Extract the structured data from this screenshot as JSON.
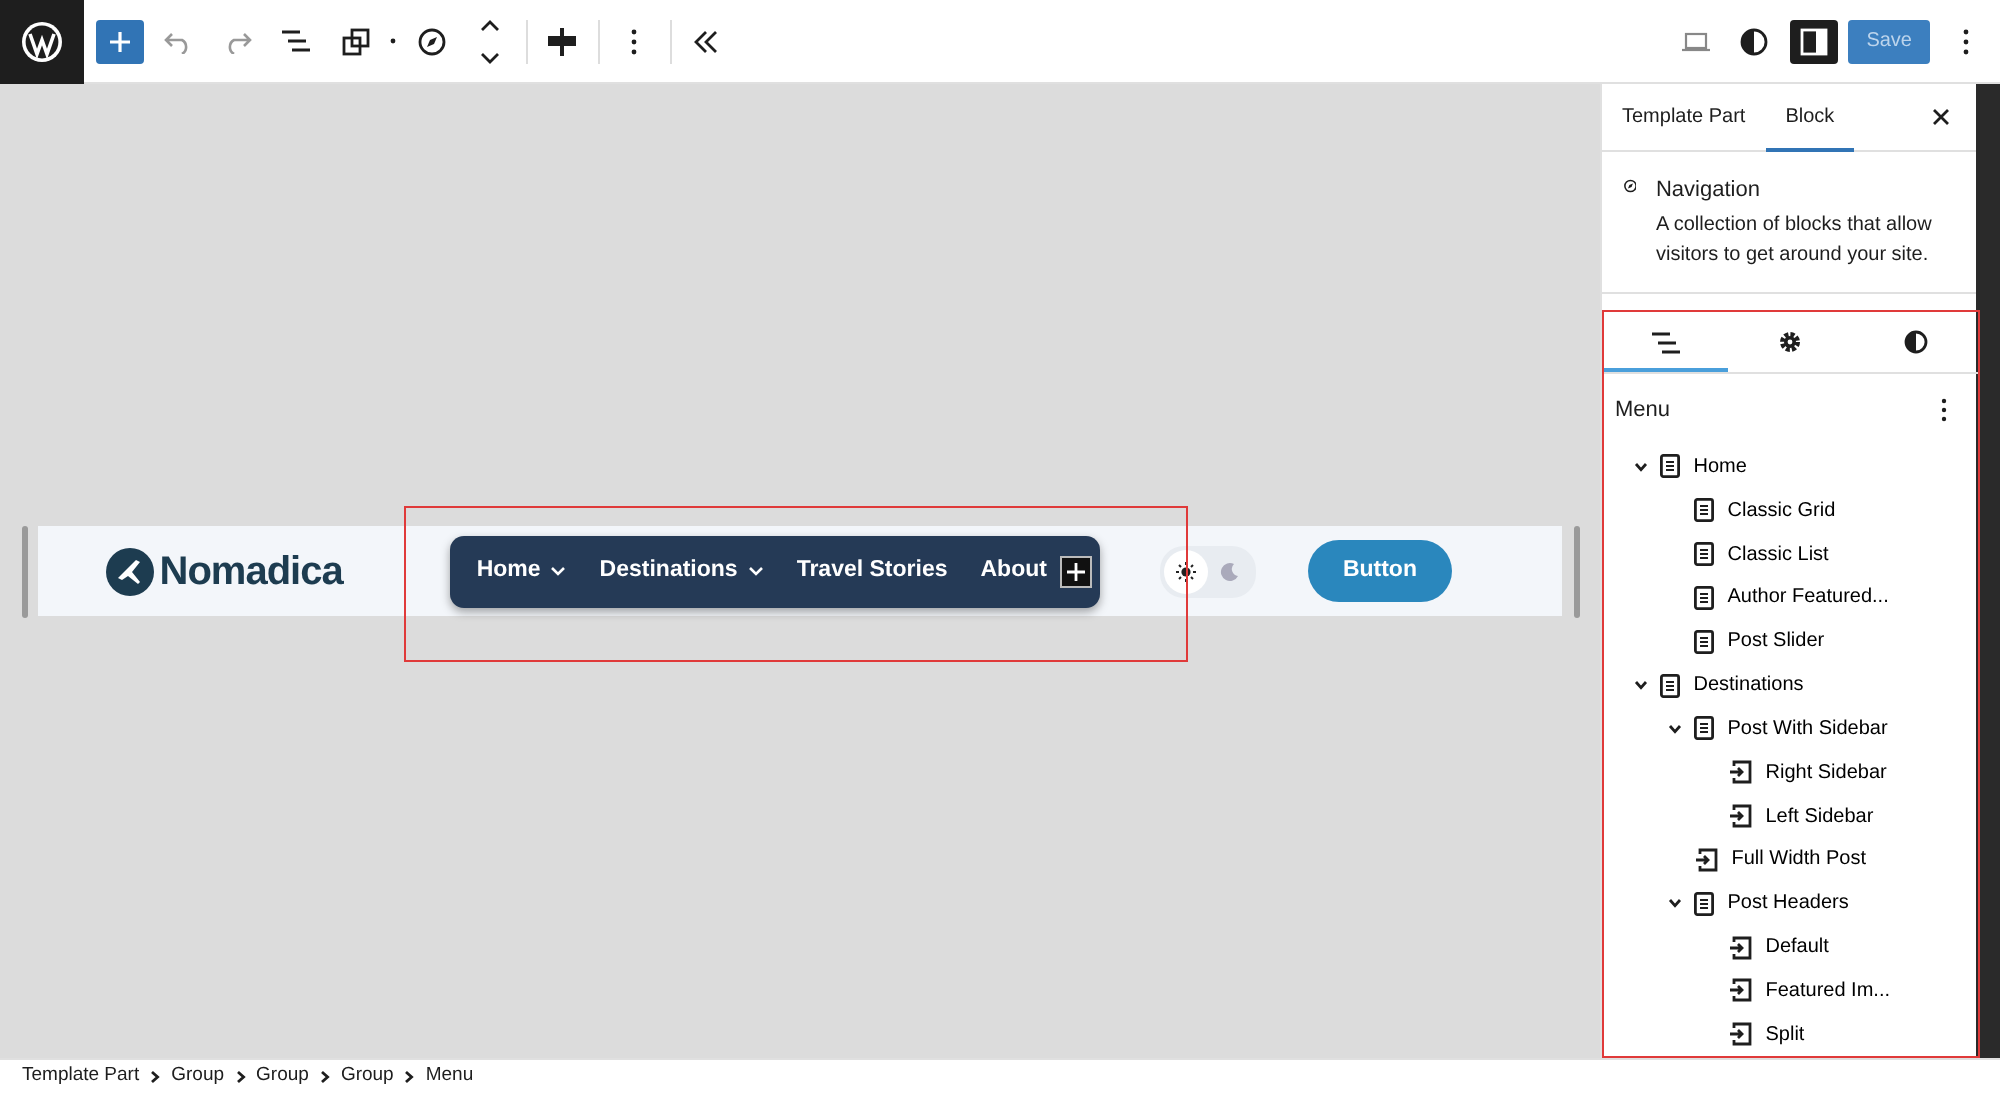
{
  "toolbar": {
    "save_label": "Save"
  },
  "canvas": {
    "site_title": "Nomadica",
    "nav_items": [
      {
        "label": "Home",
        "has_submenu": true
      },
      {
        "label": "Destinations",
        "has_submenu": true
      },
      {
        "label": "Travel Stories",
        "has_submenu": false
      },
      {
        "label": "About",
        "has_submenu": false
      }
    ],
    "theme_toggle": [
      {
        "kind": "light",
        "selected": true
      },
      {
        "kind": "dark",
        "selected": false
      }
    ],
    "button": "Button"
  },
  "sidebar": {
    "tabs": [
      {
        "label": "Template Part",
        "selected": false
      },
      {
        "label": "Block",
        "selected": true
      }
    ],
    "block": {
      "title": "Navigation",
      "description": "A collection of blocks that allow visitors to get around your site."
    },
    "panel_tabs": [
      {
        "kind": "list",
        "selected": true
      },
      {
        "kind": "settings",
        "selected": false
      },
      {
        "kind": "styles",
        "selected": false
      }
    ],
    "menu_title": "Menu",
    "tree": [
      {
        "label": "Home",
        "kind": "page",
        "expanded": true,
        "children": [
          {
            "label": "Classic Grid",
            "kind": "page"
          },
          {
            "label": "Classic List",
            "kind": "page"
          },
          {
            "label": "Author Featured...",
            "kind": "page"
          },
          {
            "label": "Post Slider",
            "kind": "page"
          }
        ]
      },
      {
        "label": "Destinations",
        "kind": "page",
        "expanded": true,
        "children": [
          {
            "label": "Post With Sidebar",
            "kind": "page",
            "expanded": true,
            "children": [
              {
                "label": "Right Sidebar",
                "kind": "link"
              },
              {
                "label": "Left Sidebar",
                "kind": "link"
              }
            ]
          },
          {
            "label": "Full Width Post",
            "kind": "link"
          },
          {
            "label": "Post Headers",
            "kind": "page",
            "expanded": true,
            "children": [
              {
                "label": "Default",
                "kind": "link"
              },
              {
                "label": "Featured Im...",
                "kind": "link"
              },
              {
                "label": "Split",
                "kind": "link"
              }
            ]
          }
        ]
      }
    ]
  },
  "breadcrumbs": [
    "Template Part",
    "Group",
    "Group",
    "Group",
    "Menu"
  ]
}
